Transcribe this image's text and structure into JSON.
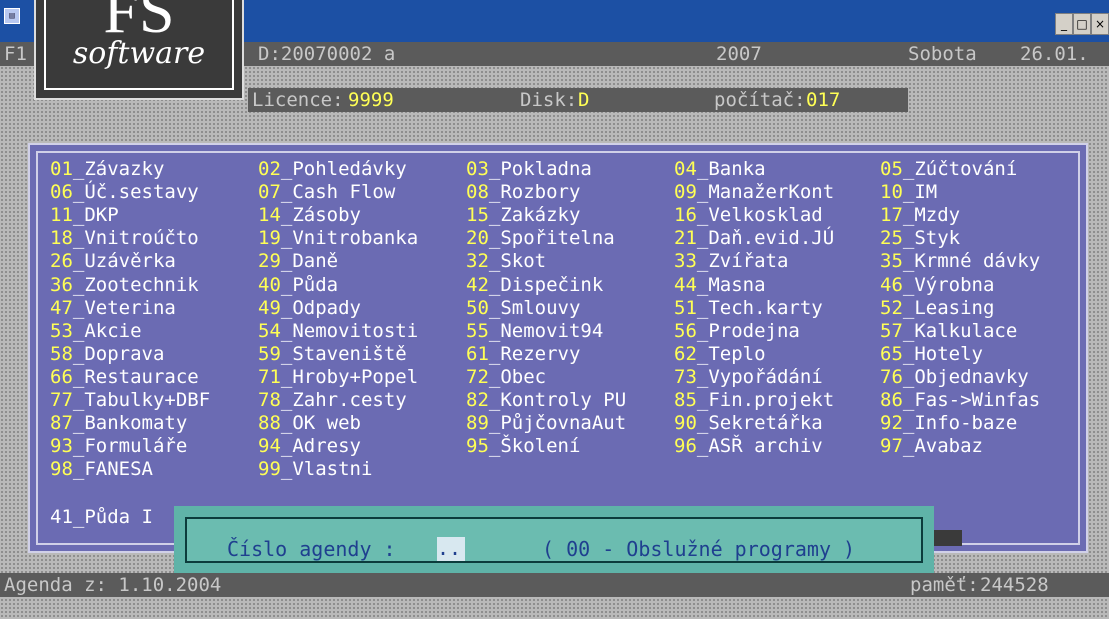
{
  "window": {
    "minimize_label": "_",
    "restore_label": "□",
    "close_label": "×",
    "app_icon": "app-icon"
  },
  "logo": {
    "mark": "FS",
    "text": "software"
  },
  "header": {
    "left": "F1",
    "id_label": "D:20070002 a",
    "year": "2007",
    "day": "Sobota",
    "date": "26.01."
  },
  "info": {
    "licence_label": "Licence:",
    "licence_value": "9999",
    "disk_label": "Disk:",
    "disk_value": "D",
    "pc_label": "počítač:",
    "pc_value": "017"
  },
  "menu": {
    "columns": [
      [
        {
          "num": "01",
          "label": "_Závazky"
        },
        {
          "num": "06",
          "label": "_Úč.sestavy"
        },
        {
          "num": "11",
          "label": "_DKP"
        },
        {
          "num": "18",
          "label": "_Vnitroúčto"
        },
        {
          "num": "26",
          "label": "_Uzávěrka"
        },
        {
          "num": "36",
          "label": "_Zootechnik"
        },
        {
          "num": "47",
          "label": "_Veterina"
        },
        {
          "num": "53",
          "label": "_Akcie"
        },
        {
          "num": "58",
          "label": "_Doprava"
        },
        {
          "num": "66",
          "label": "_Restaurace"
        },
        {
          "num": "77",
          "label": "_Tabulky+DBF"
        },
        {
          "num": "87",
          "label": "_Bankomaty"
        },
        {
          "num": "93",
          "label": "_Formuláře"
        },
        {
          "num": "98",
          "label": "_FANESA"
        }
      ],
      [
        {
          "num": "02",
          "label": "_Pohledávky"
        },
        {
          "num": "07",
          "label": "_Cash Flow"
        },
        {
          "num": "14",
          "label": "_Zásoby"
        },
        {
          "num": "19",
          "label": "_Vnitrobanka"
        },
        {
          "num": "29",
          "label": "_Daně"
        },
        {
          "num": "40",
          "label": "_Půda"
        },
        {
          "num": "49",
          "label": "_Odpady"
        },
        {
          "num": "54",
          "label": "_Nemovitosti"
        },
        {
          "num": "59",
          "label": "_Staveniště"
        },
        {
          "num": "71",
          "label": "_Hroby+Popel"
        },
        {
          "num": "78",
          "label": "_Zahr.cesty"
        },
        {
          "num": "88",
          "label": "_OK web"
        },
        {
          "num": "94",
          "label": "_Adresy"
        },
        {
          "num": "99",
          "label": "_Vlastni"
        }
      ],
      [
        {
          "num": "03",
          "label": "_Pokladna"
        },
        {
          "num": "08",
          "label": "_Rozbory"
        },
        {
          "num": "15",
          "label": "_Zakázky"
        },
        {
          "num": "20",
          "label": "_Spořitelna"
        },
        {
          "num": "32",
          "label": "_Skot"
        },
        {
          "num": "42",
          "label": "_Dispečink"
        },
        {
          "num": "50",
          "label": "_Smlouvy"
        },
        {
          "num": "55",
          "label": "_Nemovit94"
        },
        {
          "num": "61",
          "label": "_Rezervy"
        },
        {
          "num": "72",
          "label": "_Obec"
        },
        {
          "num": "82",
          "label": "_Kontroly PU"
        },
        {
          "num": "89",
          "label": "_PůjčovnaAut"
        },
        {
          "num": "95",
          "label": "_Školení"
        }
      ],
      [
        {
          "num": "04",
          "label": "_Banka"
        },
        {
          "num": "09",
          "label": "_ManažerKont"
        },
        {
          "num": "16",
          "label": "_Velkosklad"
        },
        {
          "num": "21",
          "label": "_Daň.evid.JÚ"
        },
        {
          "num": "33",
          "label": "_Zvířata"
        },
        {
          "num": "44",
          "label": "_Masna"
        },
        {
          "num": "51",
          "label": "_Tech.karty"
        },
        {
          "num": "56",
          "label": "_Prodejna"
        },
        {
          "num": "62",
          "label": "_Teplo"
        },
        {
          "num": "73",
          "label": "_Vypořádání"
        },
        {
          "num": "85",
          "label": "_Fin.projekt"
        },
        {
          "num": "90",
          "label": "_Sekretářka"
        },
        {
          "num": "96",
          "label": "_ASŘ archiv"
        }
      ],
      [
        {
          "num": "05",
          "label": "_Zúčtování"
        },
        {
          "num": "10",
          "label": "_IM"
        },
        {
          "num": "17",
          "label": "_Mzdy"
        },
        {
          "num": "25",
          "label": "_Styk"
        },
        {
          "num": "35",
          "label": "_Krmné dávky"
        },
        {
          "num": "46",
          "label": "_Výrobna"
        },
        {
          "num": "52",
          "label": "_Leasing"
        },
        {
          "num": "57",
          "label": "_Kalkulace"
        },
        {
          "num": "65",
          "label": "_Hotely"
        },
        {
          "num": "76",
          "label": "_Objednavky"
        },
        {
          "num": "86",
          "label": "_Fas->Winfas"
        },
        {
          "num": "92",
          "label": "_Info-baze"
        },
        {
          "num": "97",
          "label": "_Avabaz"
        }
      ]
    ],
    "extra": "41_Půda I"
  },
  "dialog": {
    "prompt": "Číslo agendy :",
    "input_value": "..",
    "hint": "( 00 - Obslužné programy )"
  },
  "footer": {
    "agenda": "Agenda z: 1.10.2004",
    "memory_label": "paměť:",
    "memory_value": "244528"
  }
}
